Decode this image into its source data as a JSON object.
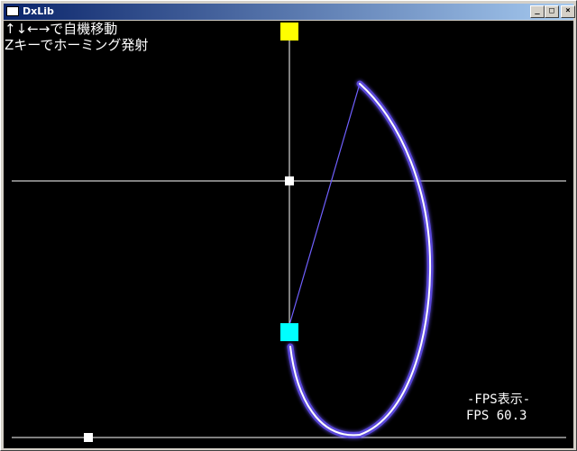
{
  "window": {
    "title": "DxLib",
    "minimize_glyph": "_",
    "maximize_glyph": "□",
    "close_glyph": "×"
  },
  "hud": {
    "line1": "↑↓←→で自機移動",
    "line2": "Zキーでホーミング発射",
    "fps_title": "-FPS表示-",
    "fps_value": "FPS 60.3"
  },
  "colors": {
    "background": "#000000",
    "enemy": "#ffff00",
    "player": "#00ffff",
    "homing_trail_core": "#ffffff",
    "homing_trail_glow": "#7060ff",
    "guide_lines": "#ffffff"
  },
  "icons": {
    "enemy": "yellow-square",
    "player": "cyan-square",
    "marker": "white-square"
  }
}
